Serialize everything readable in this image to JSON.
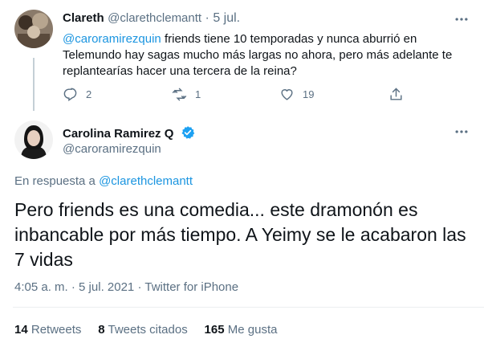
{
  "reply_tweet": {
    "author_name": "Clareth",
    "author_handle": "@clarethclemantt",
    "separator": "·",
    "date": "5 jul.",
    "mention": "@caroramirezquin",
    "text": " friends tiene 10 temporadas y nunca aburrió en Telemundo hay sagas  mucho más largas no ahora, pero más adelante te replantearías hacer una tercera de la reina?",
    "reply_count": "2",
    "retweet_count": "1",
    "like_count": "19"
  },
  "main_tweet": {
    "author_name": "Carolina Ramirez Q",
    "author_handle": "@caroramirezquin",
    "in_reply_prefix": "En respuesta a ",
    "in_reply_handle": "@clarethclemantt",
    "text": "Pero friends es una comedia... este dramonón es inbancable por más tiempo. A Yeimy se le acabaron las 7 vidas",
    "time": "4:05 a. m.",
    "date": "5 jul. 2021",
    "source": "Twitter for iPhone",
    "separator": "·"
  },
  "stats": {
    "retweets_count": "14",
    "retweets_label": "Retweets",
    "quotes_count": "8",
    "quotes_label": "Tweets citados",
    "likes_count": "165",
    "likes_label": "Me gusta"
  },
  "colors": {
    "link": "#1b95e0",
    "muted": "#5b7083",
    "verified": "#1da1f2"
  },
  "icons": [
    "more-icon",
    "reply-icon",
    "retweet-icon",
    "like-icon",
    "share-icon",
    "verified-badge-icon"
  ]
}
